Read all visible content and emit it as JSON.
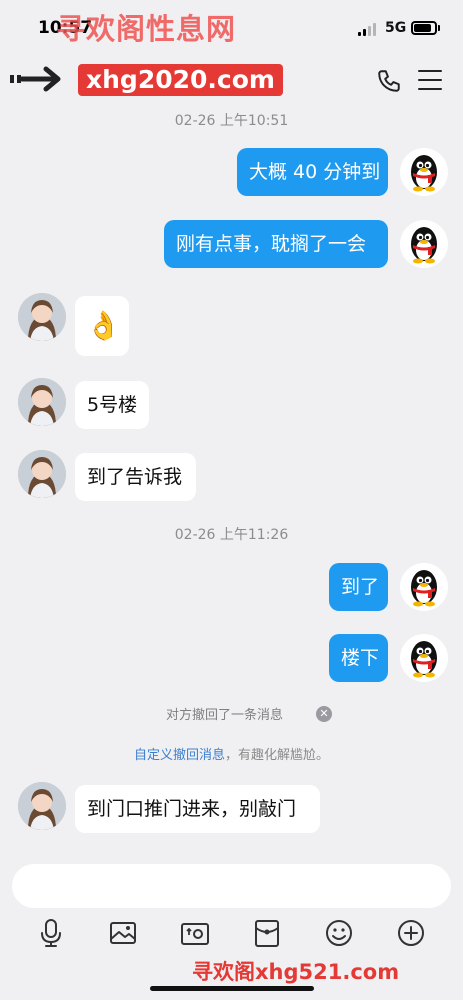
{
  "status_bar": {
    "time": "10:57",
    "network": "5G"
  },
  "watermarks": {
    "top": "寻欢阁性息网",
    "bottom": "寻欢阁xhg521.com"
  },
  "header": {
    "title": "xhg2020.com"
  },
  "messages": [
    {
      "type": "timestamp",
      "text": "02-26 上午10:51"
    },
    {
      "type": "outgoing",
      "text": "大概 40 分钟到"
    },
    {
      "type": "outgoing",
      "text": "刚有点事，耽搁了一会"
    },
    {
      "type": "incoming",
      "text": "👌"
    },
    {
      "type": "incoming",
      "text": "5号楼"
    },
    {
      "type": "incoming",
      "text": "到了告诉我"
    },
    {
      "type": "timestamp",
      "text": "02-26 上午11:26"
    },
    {
      "type": "outgoing",
      "text": "到了"
    },
    {
      "type": "outgoing",
      "text": "楼下"
    },
    {
      "type": "system",
      "text": "对方撤回了一条消息"
    },
    {
      "type": "system_tip",
      "link": "自定义撤回消息",
      "text": "，有趣化解尴尬。"
    },
    {
      "type": "incoming",
      "text": "到门口推门进来，别敲门"
    }
  ],
  "input": {
    "placeholder": ""
  },
  "toolbar": [
    "microphone-icon",
    "image-icon",
    "camera-icon",
    "red-packet-icon",
    "emoji-icon",
    "plus-icon"
  ],
  "colors": {
    "outgoing_bubble": "#1e9bf0",
    "incoming_bubble": "#ffffff",
    "background": "#f0f0f2",
    "link": "#3b7fd0"
  }
}
